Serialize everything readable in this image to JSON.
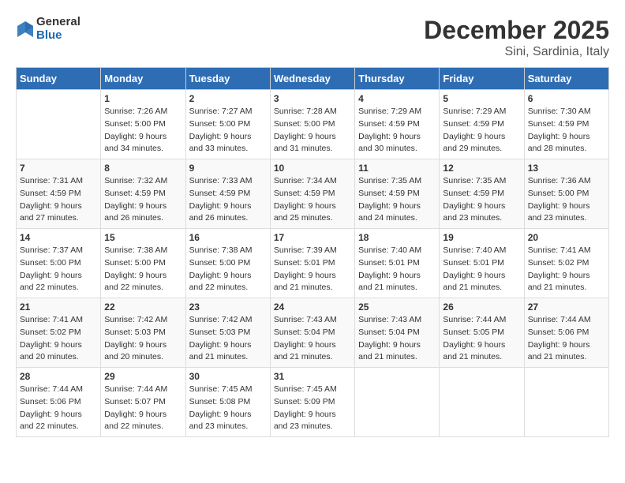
{
  "header": {
    "logo_line1": "General",
    "logo_line2": "Blue",
    "month": "December 2025",
    "location": "Sini, Sardinia, Italy"
  },
  "weekdays": [
    "Sunday",
    "Monday",
    "Tuesday",
    "Wednesday",
    "Thursday",
    "Friday",
    "Saturday"
  ],
  "weeks": [
    [
      {
        "day": "",
        "info": ""
      },
      {
        "day": "1",
        "info": "Sunrise: 7:26 AM\nSunset: 5:00 PM\nDaylight: 9 hours\nand 34 minutes."
      },
      {
        "day": "2",
        "info": "Sunrise: 7:27 AM\nSunset: 5:00 PM\nDaylight: 9 hours\nand 33 minutes."
      },
      {
        "day": "3",
        "info": "Sunrise: 7:28 AM\nSunset: 5:00 PM\nDaylight: 9 hours\nand 31 minutes."
      },
      {
        "day": "4",
        "info": "Sunrise: 7:29 AM\nSunset: 4:59 PM\nDaylight: 9 hours\nand 30 minutes."
      },
      {
        "day": "5",
        "info": "Sunrise: 7:29 AM\nSunset: 4:59 PM\nDaylight: 9 hours\nand 29 minutes."
      },
      {
        "day": "6",
        "info": "Sunrise: 7:30 AM\nSunset: 4:59 PM\nDaylight: 9 hours\nand 28 minutes."
      }
    ],
    [
      {
        "day": "7",
        "info": "Sunrise: 7:31 AM\nSunset: 4:59 PM\nDaylight: 9 hours\nand 27 minutes."
      },
      {
        "day": "8",
        "info": "Sunrise: 7:32 AM\nSunset: 4:59 PM\nDaylight: 9 hours\nand 26 minutes."
      },
      {
        "day": "9",
        "info": "Sunrise: 7:33 AM\nSunset: 4:59 PM\nDaylight: 9 hours\nand 26 minutes."
      },
      {
        "day": "10",
        "info": "Sunrise: 7:34 AM\nSunset: 4:59 PM\nDaylight: 9 hours\nand 25 minutes."
      },
      {
        "day": "11",
        "info": "Sunrise: 7:35 AM\nSunset: 4:59 PM\nDaylight: 9 hours\nand 24 minutes."
      },
      {
        "day": "12",
        "info": "Sunrise: 7:35 AM\nSunset: 4:59 PM\nDaylight: 9 hours\nand 23 minutes."
      },
      {
        "day": "13",
        "info": "Sunrise: 7:36 AM\nSunset: 5:00 PM\nDaylight: 9 hours\nand 23 minutes."
      }
    ],
    [
      {
        "day": "14",
        "info": "Sunrise: 7:37 AM\nSunset: 5:00 PM\nDaylight: 9 hours\nand 22 minutes."
      },
      {
        "day": "15",
        "info": "Sunrise: 7:38 AM\nSunset: 5:00 PM\nDaylight: 9 hours\nand 22 minutes."
      },
      {
        "day": "16",
        "info": "Sunrise: 7:38 AM\nSunset: 5:00 PM\nDaylight: 9 hours\nand 22 minutes."
      },
      {
        "day": "17",
        "info": "Sunrise: 7:39 AM\nSunset: 5:01 PM\nDaylight: 9 hours\nand 21 minutes."
      },
      {
        "day": "18",
        "info": "Sunrise: 7:40 AM\nSunset: 5:01 PM\nDaylight: 9 hours\nand 21 minutes."
      },
      {
        "day": "19",
        "info": "Sunrise: 7:40 AM\nSunset: 5:01 PM\nDaylight: 9 hours\nand 21 minutes."
      },
      {
        "day": "20",
        "info": "Sunrise: 7:41 AM\nSunset: 5:02 PM\nDaylight: 9 hours\nand 21 minutes."
      }
    ],
    [
      {
        "day": "21",
        "info": "Sunrise: 7:41 AM\nSunset: 5:02 PM\nDaylight: 9 hours\nand 20 minutes."
      },
      {
        "day": "22",
        "info": "Sunrise: 7:42 AM\nSunset: 5:03 PM\nDaylight: 9 hours\nand 20 minutes."
      },
      {
        "day": "23",
        "info": "Sunrise: 7:42 AM\nSunset: 5:03 PM\nDaylight: 9 hours\nand 21 minutes."
      },
      {
        "day": "24",
        "info": "Sunrise: 7:43 AM\nSunset: 5:04 PM\nDaylight: 9 hours\nand 21 minutes."
      },
      {
        "day": "25",
        "info": "Sunrise: 7:43 AM\nSunset: 5:04 PM\nDaylight: 9 hours\nand 21 minutes."
      },
      {
        "day": "26",
        "info": "Sunrise: 7:44 AM\nSunset: 5:05 PM\nDaylight: 9 hours\nand 21 minutes."
      },
      {
        "day": "27",
        "info": "Sunrise: 7:44 AM\nSunset: 5:06 PM\nDaylight: 9 hours\nand 21 minutes."
      }
    ],
    [
      {
        "day": "28",
        "info": "Sunrise: 7:44 AM\nSunset: 5:06 PM\nDaylight: 9 hours\nand 22 minutes."
      },
      {
        "day": "29",
        "info": "Sunrise: 7:44 AM\nSunset: 5:07 PM\nDaylight: 9 hours\nand 22 minutes."
      },
      {
        "day": "30",
        "info": "Sunrise: 7:45 AM\nSunset: 5:08 PM\nDaylight: 9 hours\nand 23 minutes."
      },
      {
        "day": "31",
        "info": "Sunrise: 7:45 AM\nSunset: 5:09 PM\nDaylight: 9 hours\nand 23 minutes."
      },
      {
        "day": "",
        "info": ""
      },
      {
        "day": "",
        "info": ""
      },
      {
        "day": "",
        "info": ""
      }
    ]
  ]
}
